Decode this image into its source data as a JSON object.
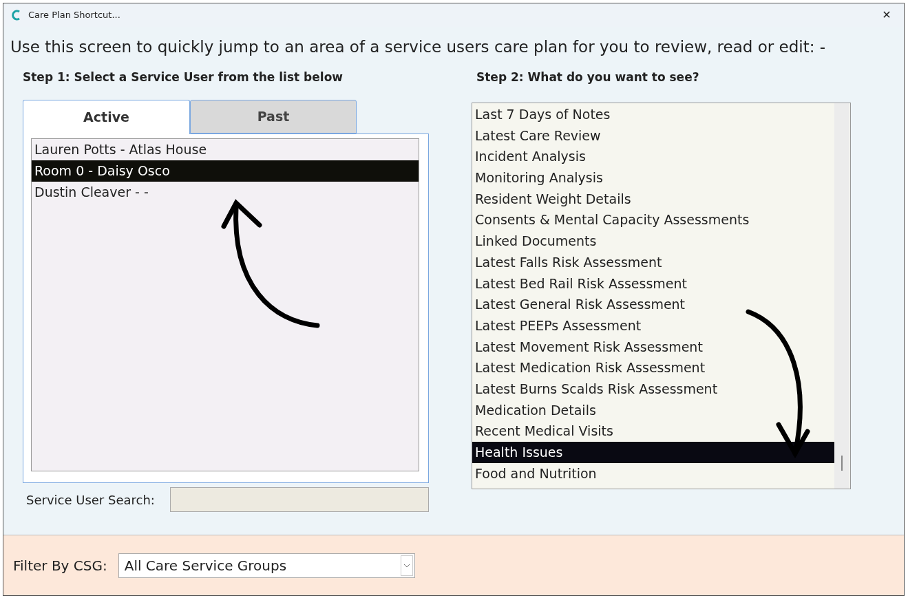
{
  "window": {
    "title": "Care Plan Shortcut...",
    "close": "✕"
  },
  "instructions": "Use this screen to quickly jump to an area of a service users care plan for you to review, read or edit: -",
  "step1": {
    "label": "Step 1: Select a Service User from the list below",
    "tabs": [
      {
        "label": "Active",
        "selected": true
      },
      {
        "label": "Past",
        "selected": false
      }
    ],
    "service_users": [
      {
        "label": "Lauren Potts - Atlas House",
        "selected": false
      },
      {
        "label": "Room 0 - Daisy Osco",
        "selected": true
      },
      {
        "label": "Dustin Cleaver - -",
        "selected": false
      }
    ],
    "search": {
      "label": "Service User Search:"
    }
  },
  "step2": {
    "label": "Step 2: What do you want to see?",
    "options": [
      {
        "label": "Last 7 Days of Notes",
        "selected": false
      },
      {
        "label": "Latest Care Review",
        "selected": false
      },
      {
        "label": "Incident Analysis",
        "selected": false
      },
      {
        "label": "Monitoring Analysis",
        "selected": false
      },
      {
        "label": "Resident Weight Details",
        "selected": false
      },
      {
        "label": "Consents & Mental Capacity Assessments",
        "selected": false
      },
      {
        "label": "Linked Documents",
        "selected": false
      },
      {
        "label": "Latest Falls Risk Assessment",
        "selected": false
      },
      {
        "label": "Latest Bed Rail Risk Assessment",
        "selected": false
      },
      {
        "label": "Latest General Risk Assessment",
        "selected": false
      },
      {
        "label": "Latest PEEPs Assessment",
        "selected": false
      },
      {
        "label": "Latest Movement Risk Assessment",
        "selected": false
      },
      {
        "label": "Latest Medication Risk Assessment",
        "selected": false
      },
      {
        "label": "Latest Burns Scalds Risk Assessment",
        "selected": false
      },
      {
        "label": "Medication Details",
        "selected": false
      },
      {
        "label": "Recent Medical Visits",
        "selected": false
      },
      {
        "label": "Health Issues",
        "selected": true
      },
      {
        "label": "Food and Nutrition",
        "selected": false
      }
    ]
  },
  "filter": {
    "label": "Filter By CSG:",
    "value": "All Care Service Groups"
  }
}
